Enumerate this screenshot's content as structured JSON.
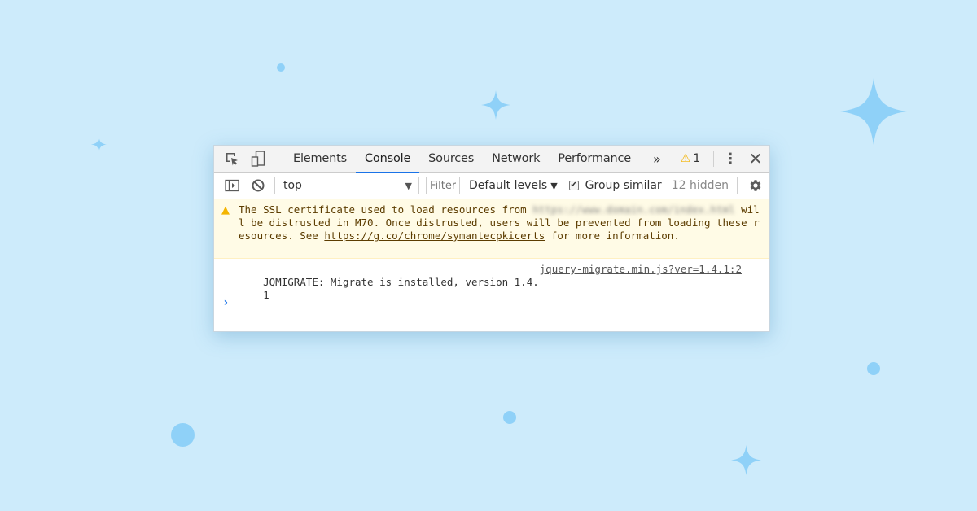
{
  "background": {
    "color": "#cdebfb",
    "accent_color": "#8fd1f8",
    "decorations": [
      "sparkle-large",
      "sparkle-medium",
      "sparkle-small",
      "sparkle-bottom",
      "dot-large",
      "dot-small-top",
      "dot-small-right",
      "dot-small-bottom"
    ]
  },
  "devtools": {
    "tabbar": {
      "inspect_icon": "inspect-element-icon",
      "device_icon": "device-toolbar-icon",
      "tabs": [
        {
          "label": "Elements",
          "active": false
        },
        {
          "label": "Console",
          "active": true
        },
        {
          "label": "Sources",
          "active": false
        },
        {
          "label": "Network",
          "active": false
        },
        {
          "label": "Performance",
          "active": false
        }
      ],
      "more_tabs": "»",
      "warning_icon": "⚠",
      "warning_count": "1",
      "menu_icon": "⋮",
      "close_icon": "✕"
    },
    "toolbar": {
      "sidebar_icon": "show-console-sidebar-icon",
      "clear_icon": "clear-console-icon",
      "context": "top",
      "filter_placeholder": "Filter",
      "levels_label": "Default levels",
      "group_similar_label": "Group similar",
      "group_similar_checked": true,
      "hidden_count": "12 hidden",
      "settings_icon": "gear-icon"
    },
    "messages": [
      {
        "type": "warning",
        "text_before": "The SSL certificate used to load resources from ",
        "blurred": "https://www.domain.com/index.html",
        "text_mid": " will be distrusted in M70. Once distrusted, users will be prevented from loading these resources. See ",
        "link": "https://g.co/chrome/symantecpkicerts",
        "text_after": " for more information."
      },
      {
        "type": "log",
        "text": "JQMIGRATE: Migrate is installed, version 1.4.1",
        "source": "jquery-migrate.min.js?ver=1.4.1:2"
      }
    ],
    "prompt": "›"
  }
}
